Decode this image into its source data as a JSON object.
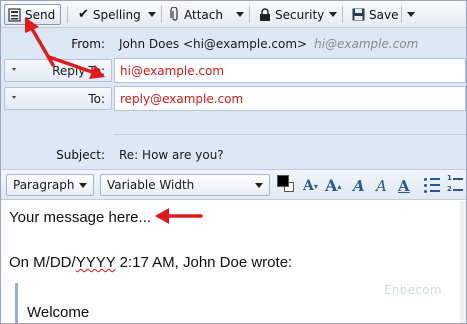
{
  "toolbar": {
    "send_label": "Send",
    "spelling_label": "Spelling",
    "attach_label": "Attach",
    "security_label": "Security",
    "save_label": "Save"
  },
  "headers": {
    "from_label": "From:",
    "from_value": "John Does <hi@example.com>",
    "from_alt": "hi@example.com",
    "replyto_label": "Reply-To:",
    "replyto_value": "hi@example.com",
    "to_label": "To:",
    "to_value": "reply@example.com",
    "subject_label": "Subject:",
    "subject_value": "Re: How are you?"
  },
  "format_bar": {
    "paragraph_select": "Paragraph",
    "font_select": "Variable Width",
    "text_color": "#000000"
  },
  "body": {
    "message": "Your message here...",
    "quote_header_prefix": "On M/DD/",
    "quote_header_misspelled": "YYYY",
    "quote_header_suffix": " 2:17 AM, John Doe wrote:",
    "quoted_text": "Welcome",
    "watermark": "Enbecom"
  },
  "colors": {
    "accent": "#27588f",
    "header_bg": "#dce8f5",
    "annotation_arrow": "#e01b1b",
    "address_red": "#d21818"
  }
}
